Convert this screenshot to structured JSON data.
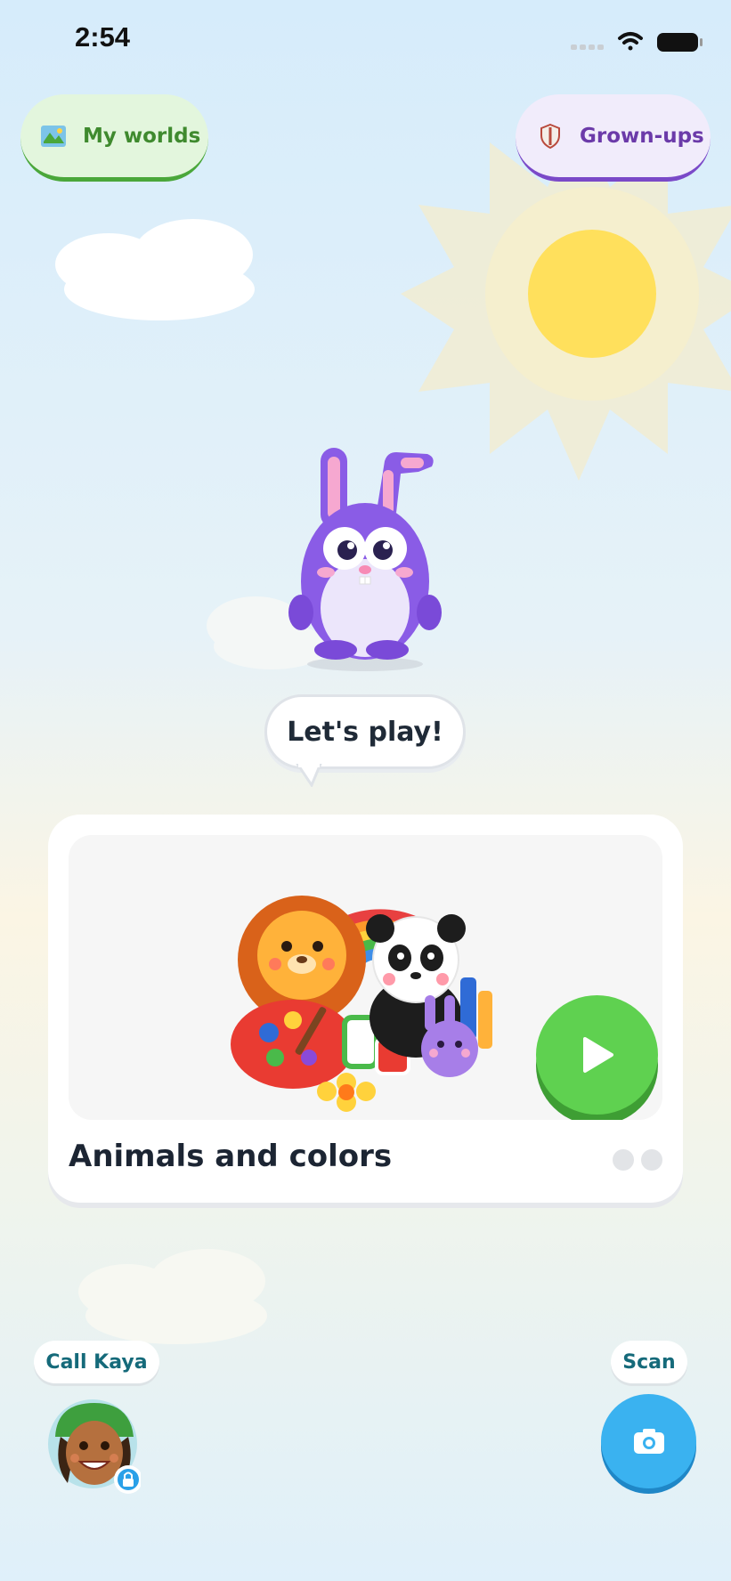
{
  "status_bar": {
    "time": "2:54",
    "icons": [
      "signal-icon",
      "wifi-icon",
      "battery-icon"
    ]
  },
  "top_nav": {
    "worlds": {
      "label": "My worlds",
      "icon": "map-icon"
    },
    "grown_ups": {
      "label": "Grown-ups",
      "icon": "shield-icon"
    }
  },
  "mascot": {
    "speech": "Let's play!"
  },
  "activity_card": {
    "title": "Animals and colors",
    "play_icon": "play-icon",
    "page_count": 2
  },
  "bottom": {
    "call_label": "Call Kaya",
    "scan_label": "Scan",
    "scan_icon": "camera-icon",
    "lock_icon": "lock-icon"
  },
  "colors": {
    "worlds_accent": "#4aa73a",
    "grownups_accent": "#7a49c8",
    "play_green": "#5fd150",
    "scan_blue": "#3ab2f0"
  }
}
